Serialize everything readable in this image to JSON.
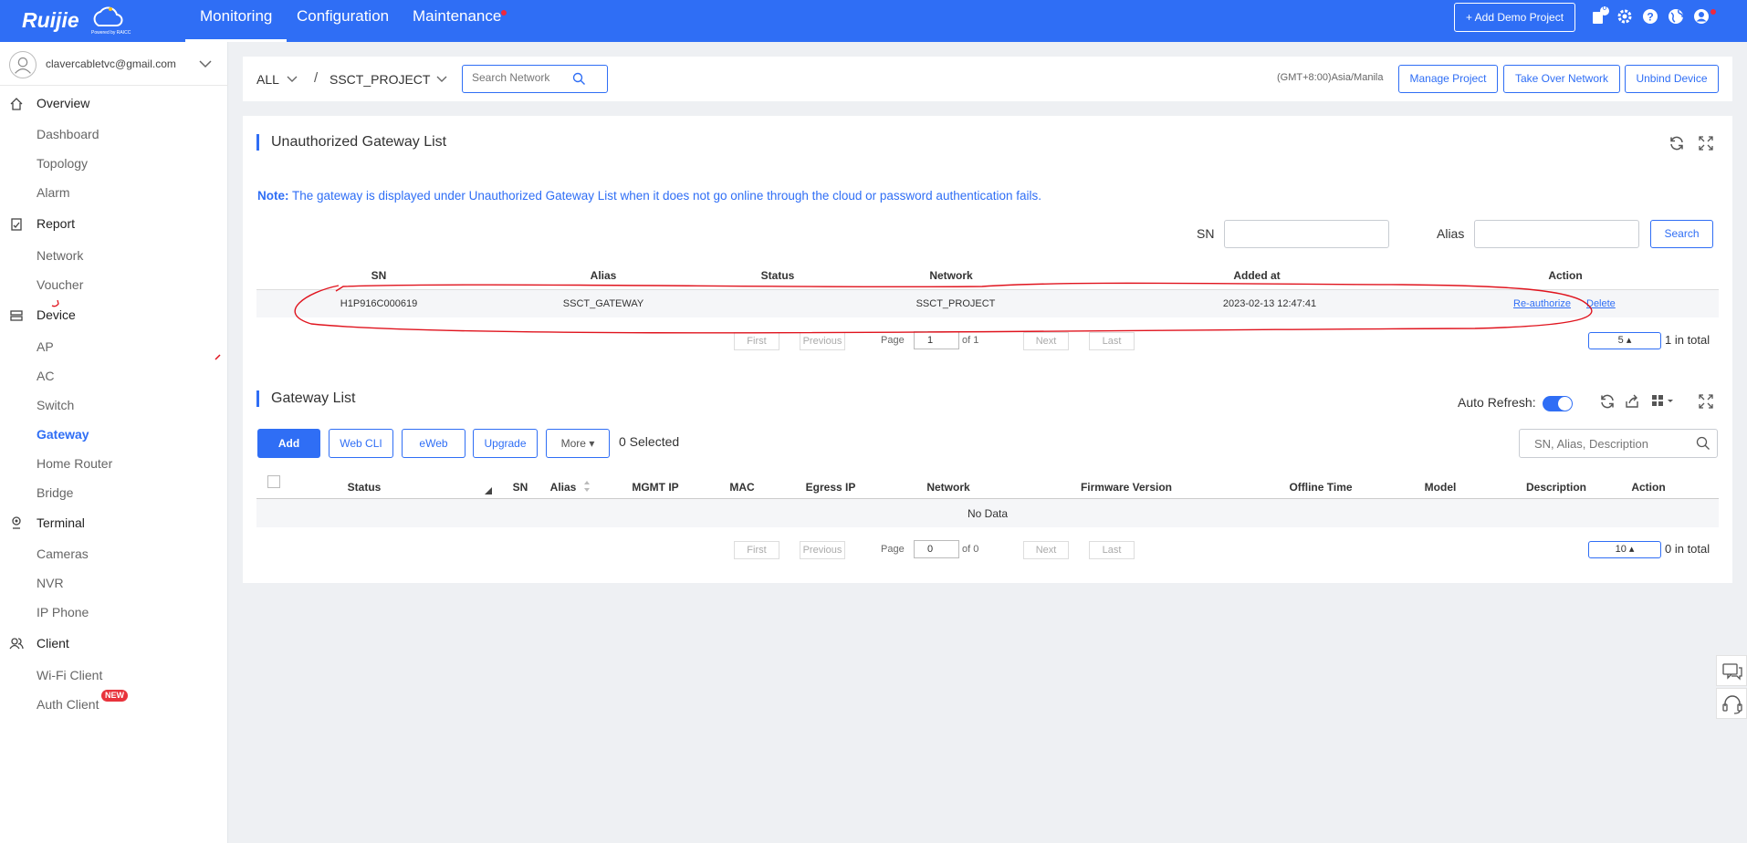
{
  "header": {
    "nav": [
      "Monitoring",
      "Configuration",
      "Maintenance"
    ],
    "add_demo": "+ Add Demo Project",
    "notif_count": "0"
  },
  "sidebar": {
    "email": "clavercabletvc@gmail.com",
    "groups": [
      {
        "label": "Overview",
        "icon": "home-icon",
        "items": [
          "Dashboard",
          "Topology",
          "Alarm"
        ]
      },
      {
        "label": "Report",
        "icon": "report-icon",
        "items": [
          "Network",
          "Voucher"
        ]
      },
      {
        "label": "Device",
        "icon": "device-icon",
        "items": [
          "AP",
          "AC",
          "Switch",
          "Gateway",
          "Home Router",
          "Bridge"
        ]
      },
      {
        "label": "Terminal",
        "icon": "camera-icon",
        "items": [
          "Cameras",
          "NVR",
          "IP Phone"
        ]
      },
      {
        "label": "Client",
        "icon": "users-icon",
        "items": [
          "Wi-Fi Client",
          "Auth Client"
        ]
      }
    ],
    "active": "Gateway",
    "new_badge": "NEW"
  },
  "toolbar": {
    "scope": "ALL",
    "sep": "/",
    "project": "SSCT_PROJECT",
    "search_placeholder": "Search Network",
    "timezone": "(GMT+8:00)Asia/Manila",
    "buttons": [
      "Manage Project",
      "Take Over Network",
      "Unbind Device"
    ]
  },
  "unauth": {
    "title": "Unauthorized Gateway List",
    "note_label": "Note:",
    "note_text": " The gateway is displayed under Unauthorized Gateway List when it does not go online through the cloud or password authentication fails.",
    "sn_label": "SN",
    "alias_label": "Alias",
    "search_btn": "Search",
    "columns": [
      "SN",
      "Alias",
      "Status",
      "Network",
      "Added at",
      "Action"
    ],
    "rows": [
      {
        "sn": "H1P916C000619",
        "alias": "SSCT_GATEWAY",
        "status": "",
        "network": "SSCT_PROJECT",
        "added": "2023-02-13 12:47:41",
        "reauth": "Re-authorize",
        "delete": "Delete"
      }
    ],
    "pager": {
      "first": "First",
      "previous": "Previous",
      "page": "Page",
      "current": "1",
      "of": "of 1",
      "next": "Next",
      "last": "Last",
      "size": "5",
      "total": "1 in total"
    }
  },
  "gateways": {
    "title": "Gateway List",
    "auto_refresh": "Auto Refresh:",
    "buttons": {
      "add": "Add",
      "webcli": "Web CLI",
      "eweb": "eWeb",
      "upgrade": "Upgrade",
      "more": "More"
    },
    "selected": "0 Selected",
    "search_placeholder": "SN, Alias, Description",
    "columns": [
      "Status",
      "SN",
      "Alias",
      "MGMT IP",
      "MAC",
      "Egress IP",
      "Network",
      "Firmware Version",
      "Offline Time",
      "Model",
      "Description",
      "Action"
    ],
    "empty": "No Data",
    "pager": {
      "first": "First",
      "previous": "Previous",
      "page": "Page",
      "current": "0",
      "of": "of 0",
      "next": "Next",
      "last": "Last",
      "size": "10",
      "total": "0 in total"
    }
  },
  "colors": {
    "primary": "#2f6ef5",
    "annotation": "#e0141e",
    "alert": "#f0283c"
  }
}
